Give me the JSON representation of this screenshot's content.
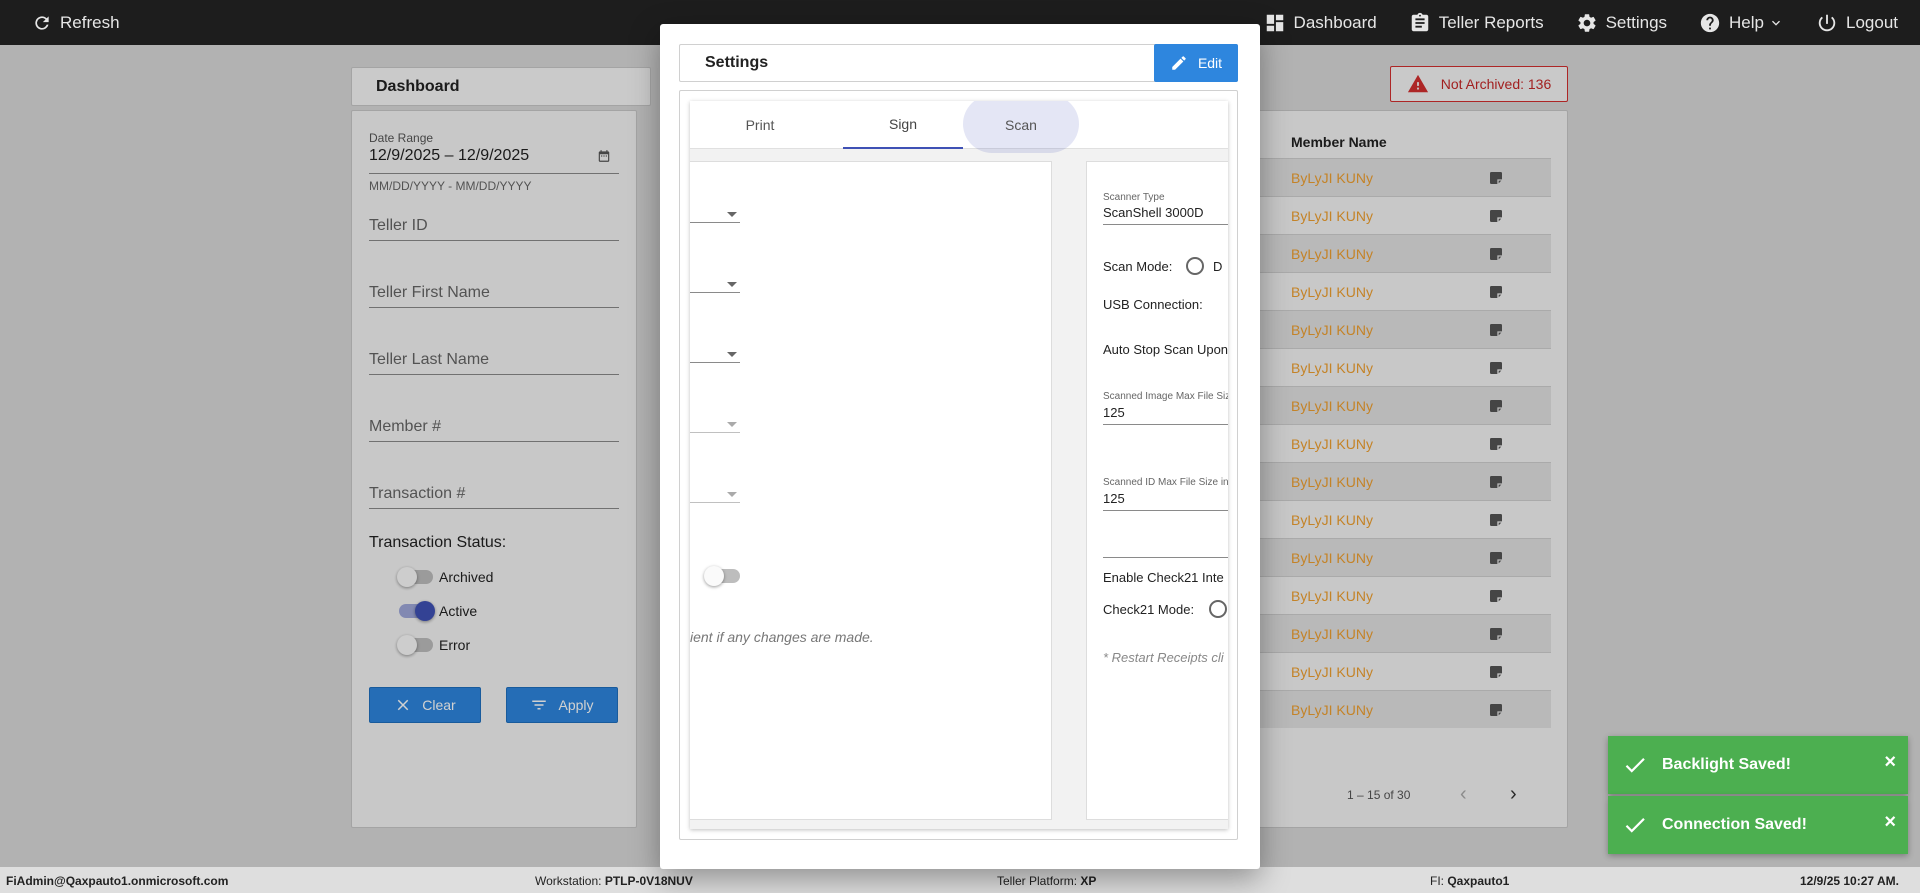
{
  "topbar": {
    "refresh_label": "Refresh",
    "nav": {
      "dashboard": "Dashboard",
      "teller_reports": "Teller Reports",
      "settings": "Settings",
      "help": "Help",
      "logout": "Logout"
    }
  },
  "dashboard": {
    "title": "Dashboard",
    "filters": {
      "date_range_label": "Date Range",
      "date_range_value": "12/9/2025 – 12/9/2025",
      "date_hint": "MM/DD/YYYY - MM/DD/YYYY",
      "teller_id": "Teller ID",
      "teller_first_name": "Teller First Name",
      "teller_last_name": "Teller Last Name",
      "member_no": "Member #",
      "transaction_no": "Transaction #",
      "status_title": "Transaction Status:",
      "statuses": [
        {
          "label": "Archived",
          "on": false
        },
        {
          "label": "Active",
          "on": true
        },
        {
          "label": "Error",
          "on": false
        }
      ],
      "clear_label": "Clear",
      "apply_label": "Apply"
    },
    "not_archived": "Not Archived: 136",
    "table": {
      "column_member_name": "Member Name",
      "rows": [
        "ByLyJI KUNy",
        "ByLyJI KUNy",
        "ByLyJI KUNy",
        "ByLyJI KUNy",
        "ByLyJI KUNy",
        "ByLyJI KUNy",
        "ByLyJI KUNy",
        "ByLyJI KUNy",
        "ByLyJI KUNy",
        "ByLyJI KUNy",
        "ByLyJI KUNy",
        "ByLyJI KUNy",
        "ByLyJI KUNy",
        "ByLyJI KUNy",
        "ByLyJI KUNy"
      ]
    },
    "pager": "1 – 15 of 30"
  },
  "settings_modal": {
    "title": "Settings",
    "edit_label": "Edit",
    "tabs": [
      "Print",
      "Sign",
      "Scan"
    ],
    "active_tab": "Sign",
    "left_note": "ient if any changes are made.",
    "scan": {
      "scanner_type_label": "Scanner Type",
      "scanner_type_value": "ScanShell 3000D",
      "scan_mode_label": "Scan Mode:",
      "scan_mode_option": "D",
      "usb_connection_label": "USB Connection:",
      "auto_stop_label": "Auto Stop Scan Upon",
      "image_max_label": "Scanned Image Max File Size",
      "image_max_value": "125",
      "id_max_label": "Scanned ID Max File Size in",
      "id_max_value": "125",
      "enable_check21_label": "Enable Check21 Inte",
      "check21_mode_label": "Check21 Mode:",
      "restart_note": "* Restart Receipts cli"
    }
  },
  "toasts": [
    {
      "message": "Backlight Saved!",
      "close": "×"
    },
    {
      "message": "Connection Saved!",
      "close": "×"
    }
  ],
  "footer": {
    "user": "FiAdmin@Qaxpauto1.onmicrosoft.com",
    "workstation_label": "Workstation:",
    "workstation_value": "PTLP-0V18NUV",
    "platform_label": "Teller Platform:",
    "platform_value": "XP",
    "fi_label": "FI:",
    "fi_value": "Qaxpauto1",
    "datetime": "12/9/25 10:27 AM."
  }
}
